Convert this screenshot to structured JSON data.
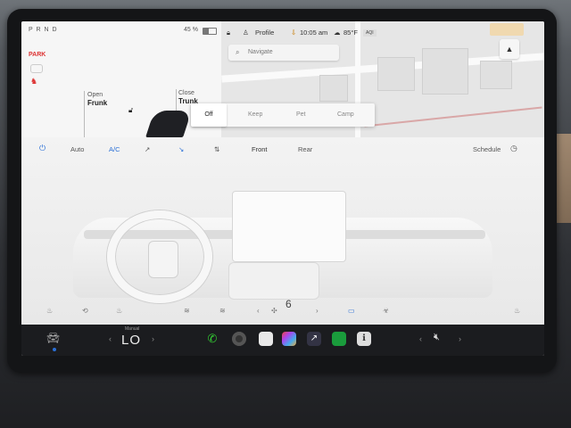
{
  "car_status": {
    "gear": "P R N D",
    "park": "PARK",
    "battery": "45 %",
    "frunk": {
      "action": "Open",
      "name": "Frunk"
    },
    "trunk": {
      "action": "Close",
      "name": "Trunk"
    }
  },
  "top_bar": {
    "profile": "Profile",
    "time": "10:05 am",
    "temperature": "85°F",
    "aqi": "AQI"
  },
  "navigate": {
    "placeholder": "Navigate"
  },
  "climate_modes": {
    "off": "Off",
    "keep": "Keep",
    "pet": "Pet",
    "camp": "Camp"
  },
  "climate_bar": {
    "auto": "Auto",
    "ac": "A/C",
    "front": "Front",
    "rear": "Rear",
    "schedule": "Schedule"
  },
  "fan": {
    "speed": "6"
  },
  "dock": {
    "temp_label": "Manual",
    "temp_value": "LO"
  },
  "colors": {
    "accent": "#2a6fd6",
    "park": "#dd3333"
  },
  "icons": [
    "power-icon",
    "defrost-icon",
    "fan-icon",
    "phone-icon",
    "camera-icon",
    "notes-icon",
    "apps-icon",
    "browser-icon",
    "spotify-icon",
    "info-icon",
    "volume-icon"
  ]
}
